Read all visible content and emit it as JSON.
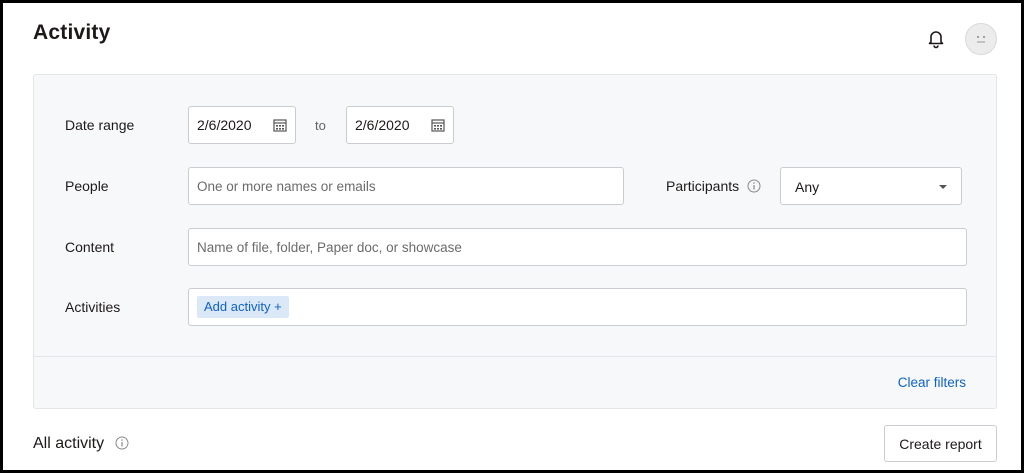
{
  "header": {
    "title": "Activity",
    "notifications_icon": "bell-icon",
    "avatar_icon": "avatar-icon"
  },
  "filters": {
    "date_range": {
      "label": "Date range",
      "from_value": "2/6/2020",
      "separator": "to",
      "to_value": "2/6/2020",
      "icon": "calendar-icon"
    },
    "people": {
      "label": "People",
      "placeholder": "One or more names or emails"
    },
    "participants": {
      "label": "Participants",
      "icon": "info-icon",
      "selected": "Any"
    },
    "content": {
      "label": "Content",
      "placeholder": "Name of file, folder, Paper doc, or showcase"
    },
    "activities": {
      "label": "Activities",
      "add_label": "Add activity +"
    },
    "clear_label": "Clear filters"
  },
  "footer": {
    "section_title": "All activity",
    "section_icon": "info-icon",
    "create_report_label": "Create report"
  },
  "colors": {
    "accent": "#0f62c4",
    "chip_bg": "#dbe8f7",
    "panel_bg": "#f7f8fa"
  }
}
